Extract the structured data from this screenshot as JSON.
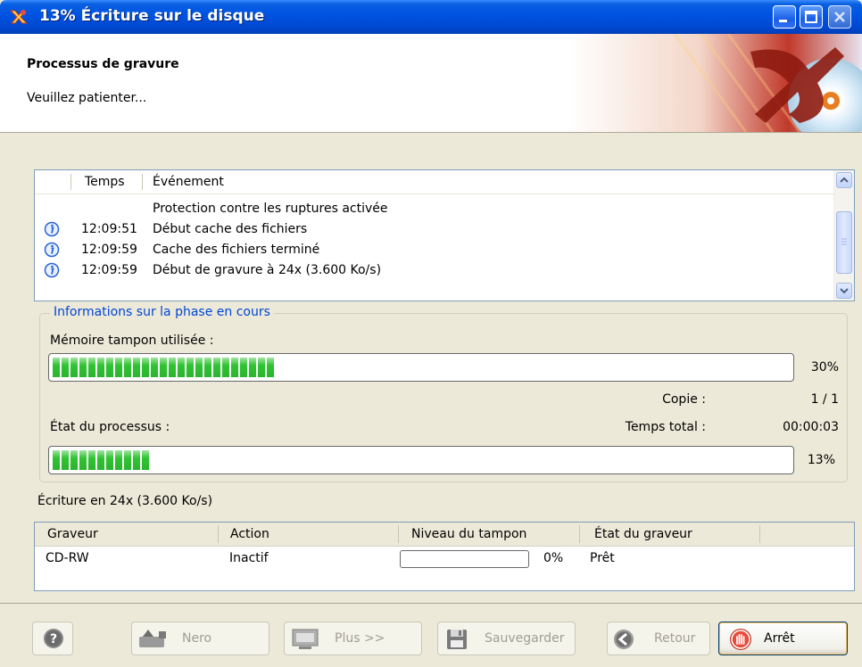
{
  "window": {
    "title": "13% Écriture sur le disque"
  },
  "header": {
    "title": "Processus de gravure",
    "subtitle": "Veuillez patienter..."
  },
  "log": {
    "columns": {
      "time": "Temps",
      "event": "Événement"
    },
    "rows": [
      {
        "icon": "",
        "time": "",
        "event": "Protection contre les ruptures activée"
      },
      {
        "icon": "info-icon",
        "time": "12:09:51",
        "event": "Début cache des fichiers"
      },
      {
        "icon": "info-icon",
        "time": "12:09:59",
        "event": "Cache des fichiers terminé"
      },
      {
        "icon": "info-icon",
        "time": "12:09:59",
        "event": "Début de gravure à 24x (3.600 Ko/s)"
      }
    ]
  },
  "phase": {
    "legend": "Informations sur la phase en cours",
    "buffer_label": "Mémoire tampon utilisée :",
    "buffer_percent_text": "30%",
    "buffer_fraction": 0.3,
    "copy_label": "Copie :",
    "copy_value": "1 / 1",
    "process_label": "État du processus :",
    "total_time_label": "Temps total :",
    "total_time_value": "00:00:03",
    "process_percent_text": "13%",
    "process_fraction": 0.13
  },
  "write_speed": "Écriture en 24x (3.600 Ko/s)",
  "writers": {
    "columns": {
      "writer": "Graveur",
      "action": "Action",
      "buffer": "Niveau du tampon",
      "state": "État du graveur"
    },
    "rows": [
      {
        "writer": "CD-RW",
        "action": "Inactif",
        "buffer_text": "0%",
        "buffer_fraction": 0,
        "state": "Prêt"
      }
    ]
  },
  "buttons": {
    "nero": "Nero",
    "more": "Plus >>",
    "save": "Sauvegarder",
    "back": "Retour",
    "stop": "Arrêt"
  },
  "colors": {
    "progress_fill": "#2fc332",
    "legend_text": "#0046d5",
    "titlebar": "#0054e3"
  }
}
